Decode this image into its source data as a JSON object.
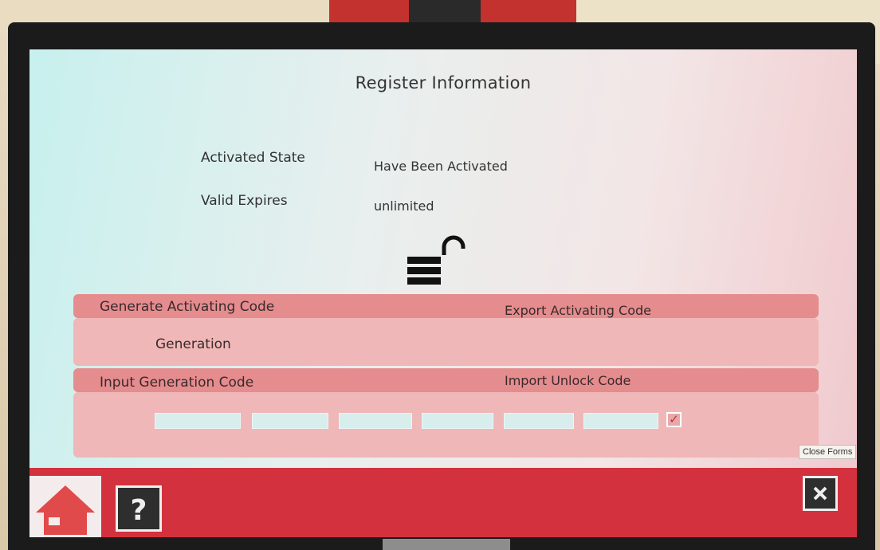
{
  "page": {
    "title": "Register Information"
  },
  "info": {
    "activated_state_label": "Activated State",
    "activated_state_value": "Have Been Activated",
    "valid_expires_label": "Valid Expires",
    "valid_expires_value": "unlimited"
  },
  "generate_section": {
    "header_left": "Generate Activating Code",
    "header_right": "Export Activating Code",
    "generation_label": "Generation"
  },
  "input_section": {
    "header_left": "Input Generation Code",
    "header_right": "Import Unlock Code",
    "code_fields": [
      "",
      "",
      "",
      "",
      "",
      ""
    ],
    "confirm_checked": true
  },
  "tooltip": {
    "close_forms": "Close Forms"
  },
  "toolbar": {
    "home_icon": "home-icon",
    "help_icon": "help-icon",
    "close_icon": "close-forms-icon"
  },
  "colors": {
    "accent_red": "#d3313d",
    "band_header": "#e58c8e",
    "band_body": "#f0b7b8"
  }
}
